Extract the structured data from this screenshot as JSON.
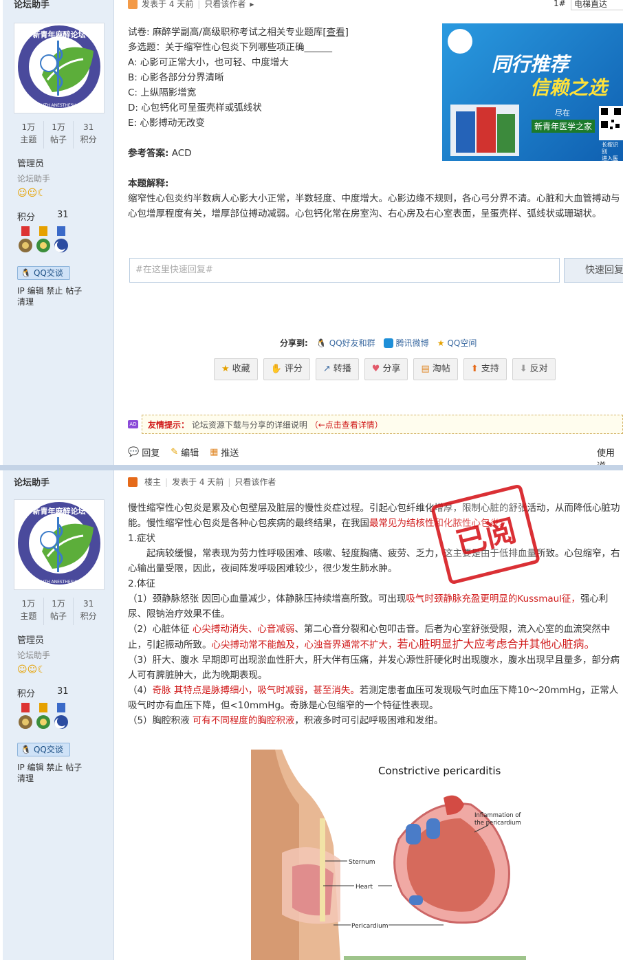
{
  "post1": {
    "author": "论坛助手",
    "meta": "发表于 4 天前",
    "only_author": "只看该作者",
    "floor": "1#",
    "elevator": "电梯直达",
    "stats": [
      {
        "value": "1万",
        "label": "主题"
      },
      {
        "value": "1万",
        "label": "帖子"
      },
      {
        "value": "31",
        "label": "积分"
      }
    ],
    "role": "管理员",
    "group": "论坛助手",
    "points_label": "积分",
    "points_value": "31",
    "qq_label": "QQ交谈",
    "admin_links_1": "IP 编辑 禁止 帖子",
    "admin_links_2": "清理",
    "question_lines": [
      "试卷: 麻醉学副高/高级职称考试之相关专业题库",
      "多选题：关于缩窄性心包炎下列哪些项正确______",
      "A: 心影可正常大小，也可轻、中度增大",
      "B: 心影各部分分界清晰",
      "C: 上纵隔影增宽",
      "D: 心包钙化可呈蛋壳样或弧线状",
      "E: 心影搏动无改变"
    ],
    "view_link": "[查看]",
    "answer_label": "参考答案:",
    "answer_value": "ACD",
    "explain_label": "本题解释:",
    "explain_text": "缩窄性心包炎约半数病人心影大小正常，半数轻度、中度增大。心影边缘不规则，各心弓分界不清。心脏和大血管搏动与心包增厚程度有关，增厚部位搏动减弱。心包钙化常在房室沟、右心房及右心室表面，呈蛋壳样、弧线状或珊瑚状。",
    "ad": {
      "line1": "同行推荐",
      "line2": "信赖之选",
      "line3": "尽在",
      "brand": "新青年医学之家",
      "qr_caption_1": "长按识别",
      "qr_caption_2": "进入医学"
    },
    "quick_reply_placeholder": "#在这里快速回复#",
    "quick_reply_button": "快速回复",
    "share_label": "分享到:",
    "share_items": [
      "QQ好友和群",
      "腾讯微博",
      "QQ空间"
    ],
    "actions": [
      "收藏",
      "评分",
      "转播",
      "分享",
      "淘帖",
      "支持",
      "反对"
    ],
    "tip_label": "友情提示：",
    "tip_text": "论坛资源下载与分享的详细说明",
    "tip_link": "（←点击查看详情）",
    "footer": [
      "回复",
      "编辑",
      "推送"
    ],
    "footer_right": "使用道"
  },
  "post2": {
    "author": "论坛助手",
    "owner": "楼主",
    "meta": "发表于 4 天前",
    "only_author": "只看该作者",
    "stats": [
      {
        "value": "1万",
        "label": "主题"
      },
      {
        "value": "1万",
        "label": "帖子"
      },
      {
        "value": "31",
        "label": "积分"
      }
    ],
    "role": "管理员",
    "group": "论坛助手",
    "points_label": "积分",
    "points_value": "31",
    "qq_label": "QQ交谈",
    "admin_links_1": "IP 编辑 禁止 帖子",
    "admin_links_2": "清理",
    "stamp_text": "已阅",
    "p1a": "慢性缩窄性心包炎是累及心包壁层及脏层的慢性炎症过程。引起心包纤维化增厚，限制心脏的舒张活动，从而降低心脏功能。慢性缩窄性心包炎是各种心包疾病的最终结果，在我国",
    "p1b": "最常见为结核性和化脓性心包炎。",
    "h1": "1.症状",
    "p2": "起病较缓慢，常表现为劳力性呼吸困难、咳嗽、轻度胸痛、疲劳、乏力，这主要是由于低排血量所致。心包缩窄，右心输出量受限，因此，夜间阵发呼吸困难较少，很少发生肺水肿。",
    "h2": "2.体征",
    "s1a": "（1）颈静脉怒张 因回心血量减少，体静脉压持续增高所致。可出现",
    "s1b": "吸气时颈静脉充盈更明显的Kussmaul征，",
    "s1c": "强心利尿、限钠治疗效果不佳。",
    "s2a": "（2）心脏体征 ",
    "s2b": "心尖搏动消失、心音减弱",
    "s2c": "、第二心音分裂和心包叩击音。后者为心室舒张受限，流入心室的血流突然中止，引起振动所致。",
    "s2d": "心尖搏动常不能触及，心浊音界通常不扩大，",
    "s2e": "若心脏明显扩大应考虑合并其他心脏病。",
    "s3": "（3）肝大、腹水 早期即可出现淤血性肝大，肝大伴有压痛，并发心源性肝硬化时出现腹水，腹水出现早且量多，部分病人可有脾脏肿大，此为晚期表现。",
    "s4a": "（4）",
    "s4b": "奇脉 其特点是脉搏细小，吸气时减弱，甚至消失。",
    "s4c": "若测定患者血压可发现吸气时血压下降10～20mmHg，正常人吸气时亦有血压下降，但<10mmHg。奇脉是心包缩窄的一个特征性表现。",
    "s5a": "（5）胸腔积液 ",
    "s5b": "可有不同程度的胸腔积液",
    "s5c": "，积液多时可引起呼吸困难和发绀。",
    "figure": {
      "title": "Constrictive pericarditis",
      "label_inflammation_1": "Inflammation of",
      "label_inflammation_2": "the pericardium",
      "label_sternum": "Sternum",
      "label_heart": "Heart",
      "label_pericardium": "Pericardium"
    }
  },
  "logo": {
    "top_text": "新青年麻醉论坛",
    "ring_text": "NEW YOUTH ANESTHESIA FORUM"
  },
  "colors": {
    "sidebar": "#e6eef7",
    "link": "#3b6aa1",
    "accent_red": "#d01a1a",
    "ad_blue": "#1b7fd0"
  }
}
